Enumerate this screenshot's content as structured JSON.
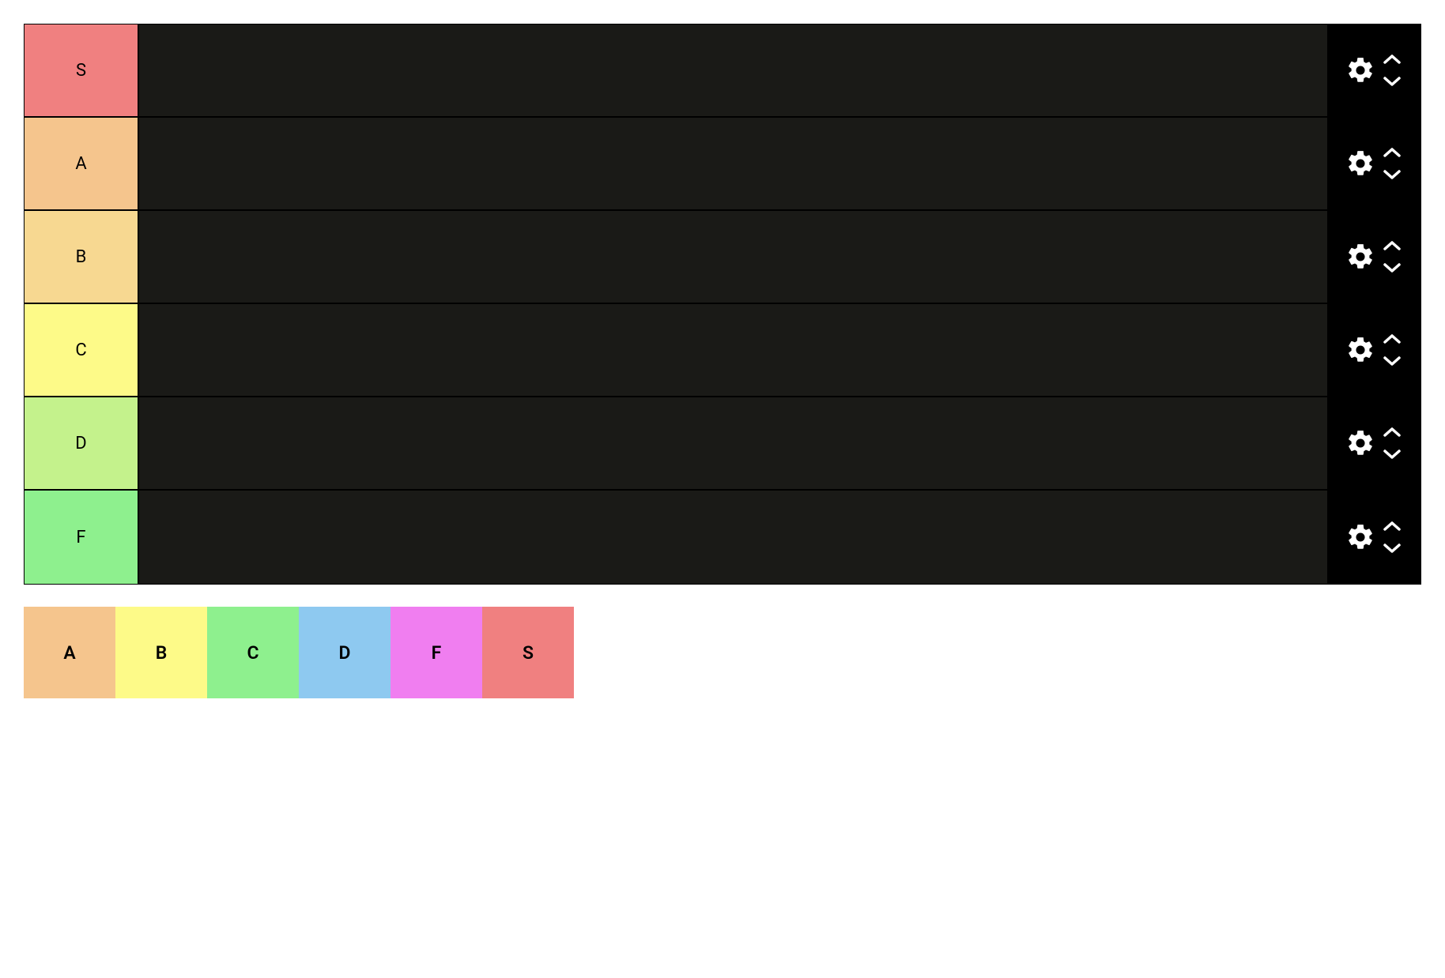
{
  "tiers": [
    {
      "label": "S",
      "color": "#f08080"
    },
    {
      "label": "A",
      "color": "#f5c58d"
    },
    {
      "label": "B",
      "color": "#f7d891"
    },
    {
      "label": "C",
      "color": "#fdfa88"
    },
    {
      "label": "D",
      "color": "#c4f28c"
    },
    {
      "label": "F",
      "color": "#8ef08e"
    }
  ],
  "tray_items": [
    {
      "label": "A",
      "color": "#f5c58d"
    },
    {
      "label": "B",
      "color": "#fdfa88"
    },
    {
      "label": "C",
      "color": "#8ef08e"
    },
    {
      "label": "D",
      "color": "#8ec9f0"
    },
    {
      "label": "F",
      "color": "#f07ef0"
    },
    {
      "label": "S",
      "color": "#f08080"
    }
  ]
}
